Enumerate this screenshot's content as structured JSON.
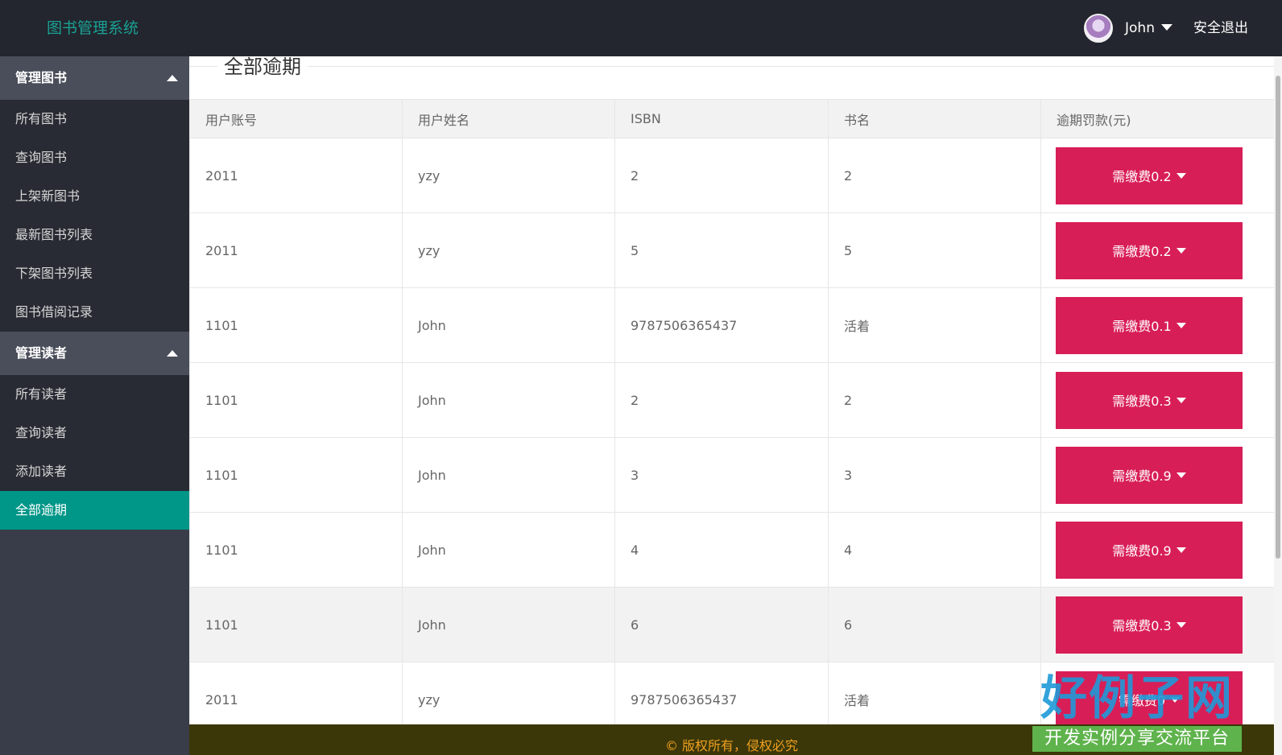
{
  "header": {
    "app_title": "图书管理系统",
    "user_name": "John",
    "logout_label": "安全退出"
  },
  "sidebar": {
    "groups": [
      {
        "label": "管理图书",
        "items": [
          "所有图书",
          "查询图书",
          "上架新图书",
          "最新图书列表",
          "下架图书列表",
          "图书借阅记录"
        ]
      },
      {
        "label": "管理读者",
        "items": [
          "所有读者",
          "查询读者",
          "添加读者",
          "全部逾期"
        ]
      }
    ],
    "active_item": "全部逾期"
  },
  "main": {
    "page_title": "全部逾期",
    "table": {
      "headers": [
        "用户账号",
        "用户姓名",
        "ISBN",
        "书名",
        "逾期罚款(元)"
      ],
      "rows": [
        {
          "account": "2011",
          "name": "yzy",
          "isbn": "2",
          "title": "2",
          "fine": "需缴费0.2"
        },
        {
          "account": "2011",
          "name": "yzy",
          "isbn": "5",
          "title": "5",
          "fine": "需缴费0.2"
        },
        {
          "account": "1101",
          "name": "John",
          "isbn": "9787506365437",
          "title": "活着",
          "fine": "需缴费0.1"
        },
        {
          "account": "1101",
          "name": "John",
          "isbn": "2",
          "title": "2",
          "fine": "需缴费0.3"
        },
        {
          "account": "1101",
          "name": "John",
          "isbn": "3",
          "title": "3",
          "fine": "需缴费0.9"
        },
        {
          "account": "1101",
          "name": "John",
          "isbn": "4",
          "title": "4",
          "fine": "需缴费0.9"
        },
        {
          "account": "1101",
          "name": "John",
          "isbn": "6",
          "title": "6",
          "fine": "需缴费0.3"
        },
        {
          "account": "2011",
          "name": "yzy",
          "isbn": "9787506365437",
          "title": "活着",
          "fine": "需缴费0"
        }
      ]
    }
  },
  "footer": {
    "text": "© 版权所有，侵权必究"
  },
  "watermark": {
    "logo_text": "好例子网",
    "logo_tagline": "开发实例分享交流平台"
  },
  "colors": {
    "topbar": "#23262e",
    "sidebar": "#393d49",
    "accent": "#009688",
    "fine_button": "#d81e57",
    "footer": "#3b3708",
    "footer_text": "#f0a020"
  }
}
